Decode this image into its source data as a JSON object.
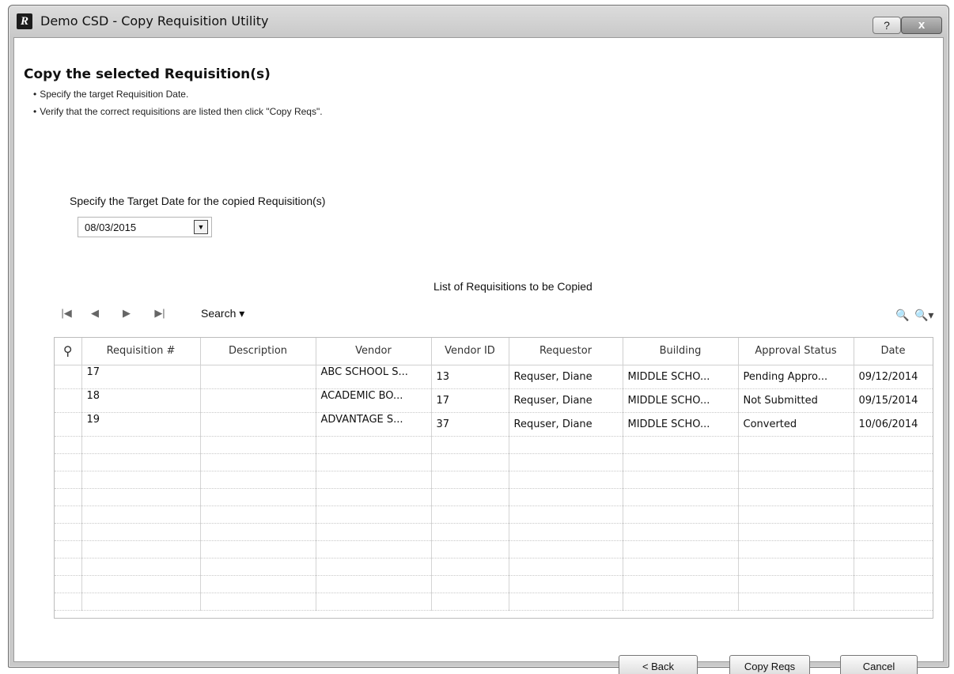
{
  "window": {
    "title": "Demo CSD - Copy Requisition Utility",
    "app_icon_letter": "R",
    "help_glyph": "?",
    "close_glyph": "x"
  },
  "page": {
    "heading": "Copy the selected Requisition(s)",
    "instructions": [
      "Specify the target Requisition Date.",
      "Verify that the correct requisitions are listed then click \"Copy Reqs\"."
    ],
    "target_label": "Specify the Target Date for the copied Requisition(s)",
    "target_date": "08/03/2015"
  },
  "grid": {
    "caption": "List of Requisitions to be Copied",
    "toolbar": {
      "first": "|◀",
      "prev": "◀",
      "next": "▶",
      "last": "▶|",
      "search_label": "Search ▾"
    },
    "columns": [
      "Requisition #",
      "Description",
      "Vendor",
      "Vendor ID",
      "Requestor",
      "Building",
      "Approval Status",
      "Date"
    ],
    "rows": [
      {
        "req": "17",
        "description": "",
        "vendor": "ABC SCHOOL S...",
        "vendor_id": "13",
        "requestor": "Requser, Diane",
        "building": "MIDDLE SCHO...",
        "status": "Pending Appro...",
        "date": "09/12/2014"
      },
      {
        "req": "18",
        "description": "",
        "vendor": "ACADEMIC BO...",
        "vendor_id": "17",
        "requestor": "Requser, Diane",
        "building": "MIDDLE SCHO...",
        "status": "Not Submitted",
        "date": "09/15/2014"
      },
      {
        "req": "19",
        "description": "",
        "vendor": "ADVANTAGE S...",
        "vendor_id": "37",
        "requestor": "Requser, Diane",
        "building": "MIDDLE SCHO...",
        "status": "Converted",
        "date": "10/06/2014"
      }
    ]
  },
  "buttons": {
    "back": "< Back",
    "copy": "Copy Reqs",
    "cancel": "Cancel"
  }
}
